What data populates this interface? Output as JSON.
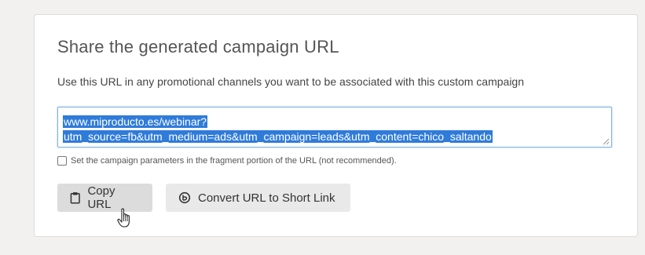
{
  "panel": {
    "title": "Share the generated campaign URL",
    "description": "Use this URL in any promotional channels you want to be associated with this custom campaign"
  },
  "url_field": {
    "line1": "www.miproducto.es/webinar?",
    "line2": "utm_source=fb&utm_medium=ads&utm_campaign=leads&utm_content=chico_saltando",
    "selected": true
  },
  "fragment_option": {
    "label": "Set the campaign parameters in the fragment portion of the URL (not recommended).",
    "checked": false
  },
  "buttons": {
    "copy_label": "Copy URL",
    "convert_label": "Convert URL to Short Link"
  },
  "icons": {
    "copy": "clipboard-icon",
    "convert": "short-link-icon",
    "cursor": "hand-pointer-icon"
  },
  "colors": {
    "selection": "#2f7bd9",
    "focus_border": "#7fb2e5"
  }
}
